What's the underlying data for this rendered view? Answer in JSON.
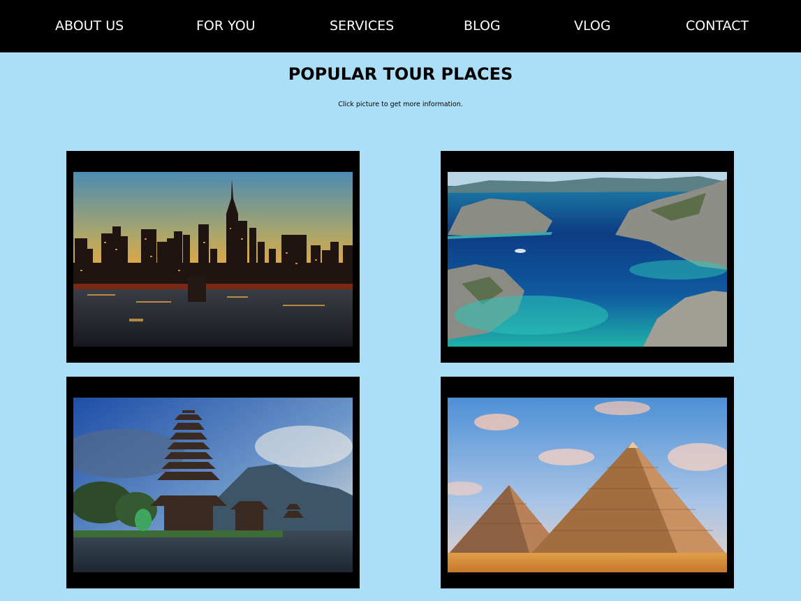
{
  "nav": {
    "items": [
      {
        "label": "ABOUT US"
      },
      {
        "label": "FOR YOU"
      },
      {
        "label": "SERVICES"
      },
      {
        "label": "BLOG"
      },
      {
        "label": "VLOG"
      },
      {
        "label": "CONTACT"
      }
    ]
  },
  "main": {
    "title": "POPULAR TOUR PLACES",
    "subtitle": "Click picture to get more information."
  },
  "colors": {
    "page_background": "#abdff8",
    "navbar_background": "#000000",
    "card_frame": "#000000"
  }
}
